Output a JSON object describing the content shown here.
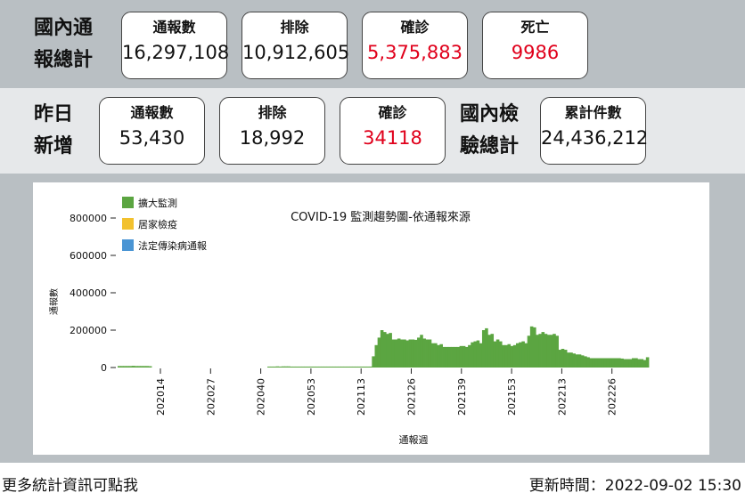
{
  "national_totals": {
    "label_line1": "國內通",
    "label_line2": "報總計",
    "cards": [
      {
        "title": "通報數",
        "value": "16,297,108",
        "color": "#111111"
      },
      {
        "title": "排除",
        "value": "10,912,605",
        "color": "#111111"
      },
      {
        "title": "確診",
        "value": "5,375,883",
        "color": "#e0001b"
      },
      {
        "title": "死亡",
        "value": "9986",
        "color": "#e0001b"
      }
    ]
  },
  "yesterday_new": {
    "label_line1": "昨日",
    "label_line2": "新增",
    "cards": [
      {
        "title": "通報數",
        "value": "53,430",
        "color": "#111111"
      },
      {
        "title": "排除",
        "value": "18,992",
        "color": "#111111"
      },
      {
        "title": "確診",
        "value": "34118",
        "color": "#e0001b"
      }
    ]
  },
  "tests_total": {
    "label_line1": "國內檢",
    "label_line2": "驗總計",
    "card": {
      "title": "累計件數",
      "value": "24,436,212"
    }
  },
  "chart_data": {
    "type": "area",
    "title": "COVID-19 監測趨勢圖-依通報來源",
    "xlabel": "通報週",
    "ylabel": "通報數",
    "ylim": [
      0,
      900000
    ],
    "yticks": [
      0,
      200000,
      400000,
      600000,
      800000
    ],
    "ytick_labels": [
      "0",
      "200000",
      "400000",
      "600000",
      "800000"
    ],
    "xtick_labels": [
      "202014",
      "202027",
      "202040",
      "202053",
      "202113",
      "202126",
      "202139",
      "202153",
      "202213",
      "202226"
    ],
    "legend_position": "top-left",
    "series": [
      {
        "name": "擴大監測",
        "color": "#5ba541",
        "values": [
          8000,
          8000,
          8000,
          8000,
          8000,
          9000,
          8000,
          8000,
          8000,
          8000,
          8000,
          7000,
          0,
          0,
          0,
          0,
          0,
          0,
          0,
          0,
          0,
          0,
          0,
          0,
          0,
          0,
          0,
          0,
          0,
          0,
          0,
          0,
          0,
          0,
          0,
          0,
          0,
          0,
          0,
          0,
          0,
          0,
          0,
          0,
          0,
          0,
          0,
          0,
          0,
          0,
          0,
          0,
          0,
          5000,
          5000,
          5000,
          6000,
          5000,
          6000,
          6000,
          6000,
          5000,
          5000,
          5000,
          5000,
          5000,
          5000,
          5000,
          5000,
          5000,
          5000,
          5000,
          5000,
          5000,
          5000,
          5000,
          5000,
          5000,
          5000,
          5000,
          5000,
          5000,
          5000,
          5000,
          5000,
          5000,
          5000,
          5000,
          5000,
          5000,
          60000,
          120000,
          160000,
          200000,
          190000,
          180000,
          185000,
          150000,
          150000,
          155000,
          150000,
          150000,
          145000,
          150000,
          150000,
          148000,
          160000,
          175000,
          155000,
          150000,
          150000,
          130000,
          130000,
          120000,
          125000,
          110000,
          110000,
          110000,
          110000,
          110000,
          110000,
          115000,
          115000,
          110000,
          120000,
          135000,
          140000,
          145000,
          130000,
          200000,
          210000,
          175000,
          180000,
          140000,
          150000,
          140000,
          120000,
          120000,
          125000,
          115000,
          120000,
          130000,
          135000,
          140000,
          130000,
          170000,
          220000,
          215000,
          175000,
          180000,
          190000,
          180000,
          175000,
          175000,
          180000,
          170000,
          95000,
          100000,
          95000,
          80000,
          80000,
          75000,
          70000,
          70000,
          65000,
          60000,
          55000,
          50000,
          50000,
          50000,
          50000,
          50000,
          50000,
          50000,
          50000,
          50000,
          50000,
          50000,
          48000,
          45000,
          45000,
          45000,
          50000,
          50000,
          45000,
          45000,
          40000,
          55000
        ]
      },
      {
        "name": "居家檢疫",
        "color": "#f2c12e",
        "values": [
          0,
          0,
          0,
          0,
          0,
          0,
          0,
          0,
          0,
          0,
          0,
          0,
          0,
          0,
          0,
          0,
          0,
          0,
          0,
          0,
          0,
          0,
          0,
          0,
          0,
          0,
          0,
          0,
          0,
          0,
          0,
          0,
          0,
          0,
          0,
          0,
          0,
          0,
          0,
          0,
          0,
          0,
          0,
          0,
          0,
          0,
          0,
          0,
          0,
          0,
          0,
          0,
          0,
          0,
          0,
          0,
          0,
          0,
          0,
          0,
          0,
          0,
          0,
          0,
          0,
          0,
          0,
          0,
          0,
          0,
          0,
          0,
          0,
          0,
          0,
          0,
          0,
          0,
          0,
          0,
          0,
          0,
          0,
          0,
          0,
          0,
          0,
          0,
          0,
          0,
          0,
          0,
          0,
          0,
          0,
          0,
          0,
          0,
          0,
          0,
          0,
          0,
          0,
          0,
          0,
          0,
          0,
          0,
          0,
          0,
          0,
          0,
          0,
          0,
          0,
          0,
          0,
          0,
          0,
          0,
          0,
          0,
          0,
          0,
          0,
          0,
          0,
          0,
          0,
          0,
          0,
          0,
          0,
          0,
          0,
          0,
          0,
          0,
          0,
          0,
          0,
          0,
          0,
          0,
          0,
          0,
          0,
          0,
          0,
          0,
          0,
          0,
          0,
          0,
          0,
          0,
          0,
          0,
          0,
          0,
          0,
          0,
          0,
          0,
          0,
          0,
          0,
          0,
          0,
          0,
          0,
          0,
          0,
          0,
          0,
          0,
          0,
          0,
          0,
          0,
          0,
          0,
          0,
          0,
          0,
          0,
          0,
          0,
          0,
          0,
          0,
          0,
          0
        ]
      },
      {
        "name": "法定傳染病通報",
        "color": "#4a95d4",
        "values": [
          0,
          0,
          0,
          0,
          0,
          0,
          0,
          0,
          0,
          0,
          0,
          0,
          0,
          0,
          0,
          0,
          0,
          0,
          0,
          0,
          0,
          0,
          0,
          0,
          0,
          0,
          0,
          0,
          0,
          0,
          0,
          0,
          0,
          0,
          0,
          0,
          0,
          0,
          0,
          0,
          0,
          0,
          0,
          0,
          0,
          0,
          0,
          0,
          0,
          0,
          0,
          0,
          0,
          0,
          0,
          0,
          0,
          0,
          0,
          0,
          0,
          0,
          0,
          0,
          0,
          0,
          0,
          0,
          0,
          0,
          0,
          0,
          0,
          0,
          0,
          0,
          0,
          0,
          0,
          0,
          0,
          0,
          0,
          0,
          0,
          0,
          0,
          0,
          0,
          0,
          0,
          0,
          0,
          0,
          0,
          0,
          0,
          0,
          0,
          0,
          0,
          0,
          0,
          0,
          0,
          0,
          0,
          0,
          0,
          0,
          0,
          0,
          0,
          0,
          0,
          0,
          0,
          0,
          0,
          0,
          0,
          0,
          0,
          0,
          0,
          0,
          0,
          0,
          0,
          0,
          0,
          0,
          0,
          0,
          0,
          0,
          0,
          0,
          0,
          0,
          0,
          0,
          0,
          0,
          0,
          0,
          0,
          0,
          0,
          0,
          0,
          0,
          0,
          0,
          0,
          0,
          0,
          0,
          0,
          0,
          0,
          0,
          0,
          0,
          0,
          0,
          0,
          0,
          0,
          0,
          0,
          0,
          0,
          0,
          0,
          0,
          0,
          0,
          0,
          0,
          0,
          0,
          0,
          0,
          0,
          0,
          0,
          0,
          0,
          0,
          0,
          0,
          0
        ]
      }
    ]
  },
  "footer": {
    "link_text": "更多統計資訊可點我",
    "update_time": "更新時間：2022-09-02 15:30"
  }
}
